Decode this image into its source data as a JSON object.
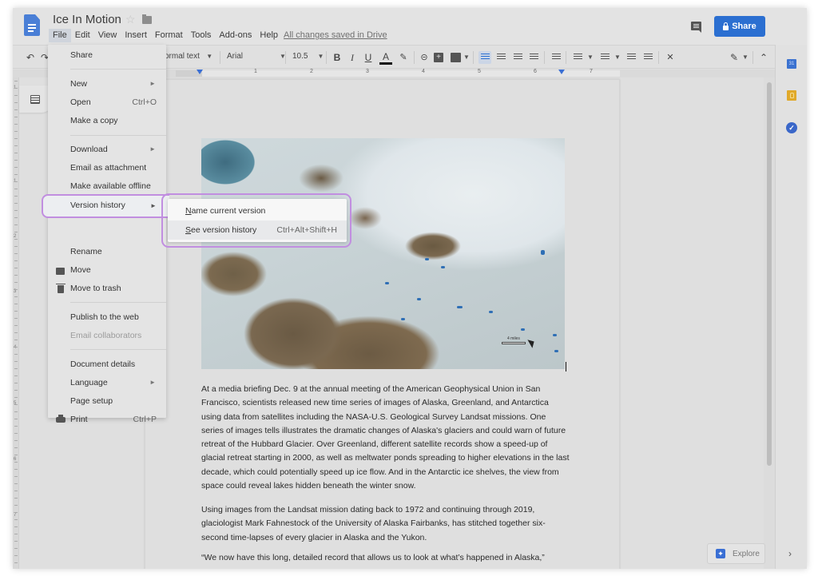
{
  "header": {
    "doc_title": "Ice In Motion",
    "star_icon": "☆",
    "saved_status": "All changes saved in Drive",
    "share_label": "Share",
    "menu": [
      "File",
      "Edit",
      "View",
      "Insert",
      "Format",
      "Tools",
      "Add-ons",
      "Help"
    ],
    "active_menu": "File"
  },
  "toolbar": {
    "style_value": "ormal text",
    "font_value": "Arial",
    "size_value": "10.5",
    "bold": "B",
    "italic": "I",
    "underline": "U",
    "text_color": "A",
    "undo_icon": "↶",
    "redo_icon": "↷",
    "clear_format_icon": "✕",
    "edit_mode_icon": "✎",
    "collapse_icon": "⌃"
  },
  "ruler": {
    "numbers": [
      "1",
      "2",
      "3",
      "4",
      "5",
      "6",
      "7"
    ],
    "vertical_numbers": [
      "1",
      "1",
      "2",
      "3",
      "4",
      "5",
      "6",
      "7"
    ]
  },
  "file_menu": {
    "items": [
      {
        "label": "Share"
      },
      {
        "label": "New",
        "submenu": true
      },
      {
        "label": "Open",
        "shortcut": "Ctrl+O"
      },
      {
        "label": "Make a copy"
      },
      {
        "label": "Download",
        "submenu": true
      },
      {
        "label": "Email as attachment"
      },
      {
        "label": "Make available offline"
      },
      {
        "label": "Version history",
        "submenu": true
      },
      {
        "label": "Rename"
      },
      {
        "label": "Move",
        "icon": "folder-icon"
      },
      {
        "label": "Move to trash",
        "icon": "trash-icon"
      },
      {
        "label": "Publish to the web"
      },
      {
        "label": "Email collaborators",
        "disabled": true
      },
      {
        "label": "Document details"
      },
      {
        "label": "Language",
        "submenu": true
      },
      {
        "label": "Page setup"
      },
      {
        "label": "Print",
        "shortcut": "Ctrl+P",
        "icon": "print-icon"
      }
    ],
    "submenu_arrow": "►"
  },
  "version_submenu": {
    "items": [
      {
        "label_first": "N",
        "label_rest": "ame current version"
      },
      {
        "label_first": "S",
        "label_rest": "ee version history",
        "shortcut": "Ctrl+Alt+Shift+H"
      }
    ]
  },
  "document": {
    "image_scale_label": "4 miles",
    "paragraphs": [
      "At a media briefing Dec. 9 at the annual meeting of the American Geophysical Union in San Francisco, scientists released new time series of images of Alaska, Greenland, and Antarctica using data from satellites including the NASA-U.S. Geological Survey Landsat missions. One series of images tells illustrates the dramatic changes of Alaska's glaciers and could warn of future retreat of the Hubbard Glacier. Over Greenland, different satellite records show a speed-up of glacial retreat starting in 2000, as well as meltwater ponds spreading to higher elevations in the last decade, which could potentially speed up ice flow. And in the Antarctic ice shelves, the view from space could reveal lakes hidden beneath the winter snow.",
      "Using images from the Landsat mission dating back to 1972 and continuing through 2019, glaciologist Mark Fahnestock of the University of Alaska Fairbanks, has stitched together six-second time-lapses of every glacier in Alaska and the Yukon.",
      "“We now have this long, detailed record that allows us to look at what’s happened in Alaska,”"
    ]
  },
  "side_panel": {
    "calendar_label": "31",
    "tasks_glyph": "✓",
    "expand_icon": "›"
  },
  "explore": {
    "label": "Explore",
    "icon": "✦"
  },
  "colors": {
    "accent": "#2b6fd1",
    "highlight_outline": "#c18ee0",
    "keep": "#e0a92a"
  }
}
